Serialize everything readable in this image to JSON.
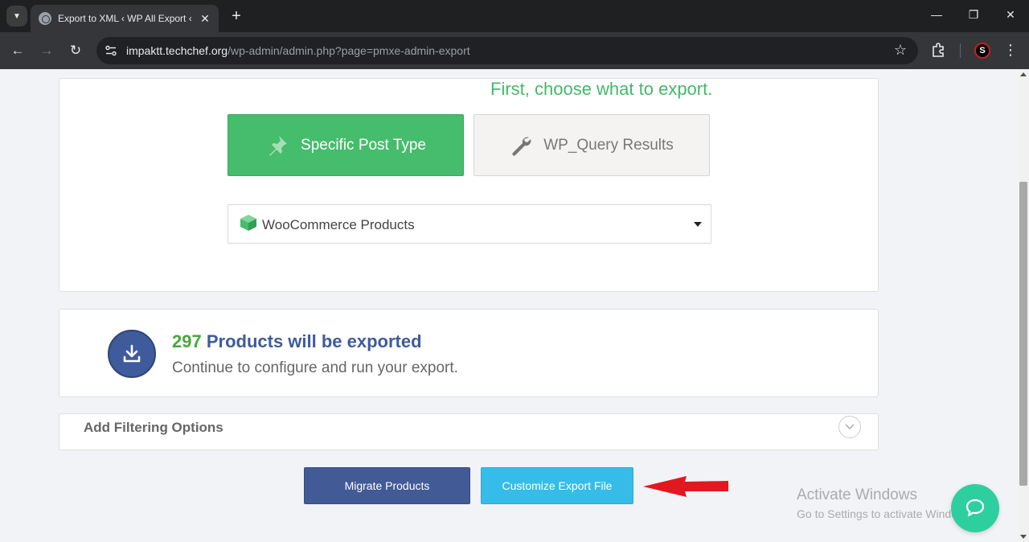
{
  "browser": {
    "tab_title": "Export to XML ‹ WP All Export ‹",
    "url_host": "impaktt.techchef.org",
    "url_path": "/wp-admin/admin.php?page=pmxe-admin-export",
    "profile_initial": "S"
  },
  "export": {
    "heading": "First, choose what to export.",
    "type_specific_label": "Specific Post Type",
    "type_query_label": "WP_Query Results",
    "post_type_selected": "WooCommerce Products"
  },
  "summary": {
    "count": "297",
    "count_label": "Products will be exported",
    "subtitle": "Continue to configure and run your export."
  },
  "filter": {
    "label": "Add Filtering Options"
  },
  "actions": {
    "migrate_label": "Migrate Products",
    "customize_label": "Customize Export File"
  },
  "watermark": {
    "line1": "Activate Windows",
    "line2": "Go to Settings to activate Windows."
  },
  "colors": {
    "green": "#46bd6c",
    "blue": "#425a96",
    "cyan": "#36bce8",
    "chat": "#2ecf9e",
    "arrow": "#e3171f"
  }
}
